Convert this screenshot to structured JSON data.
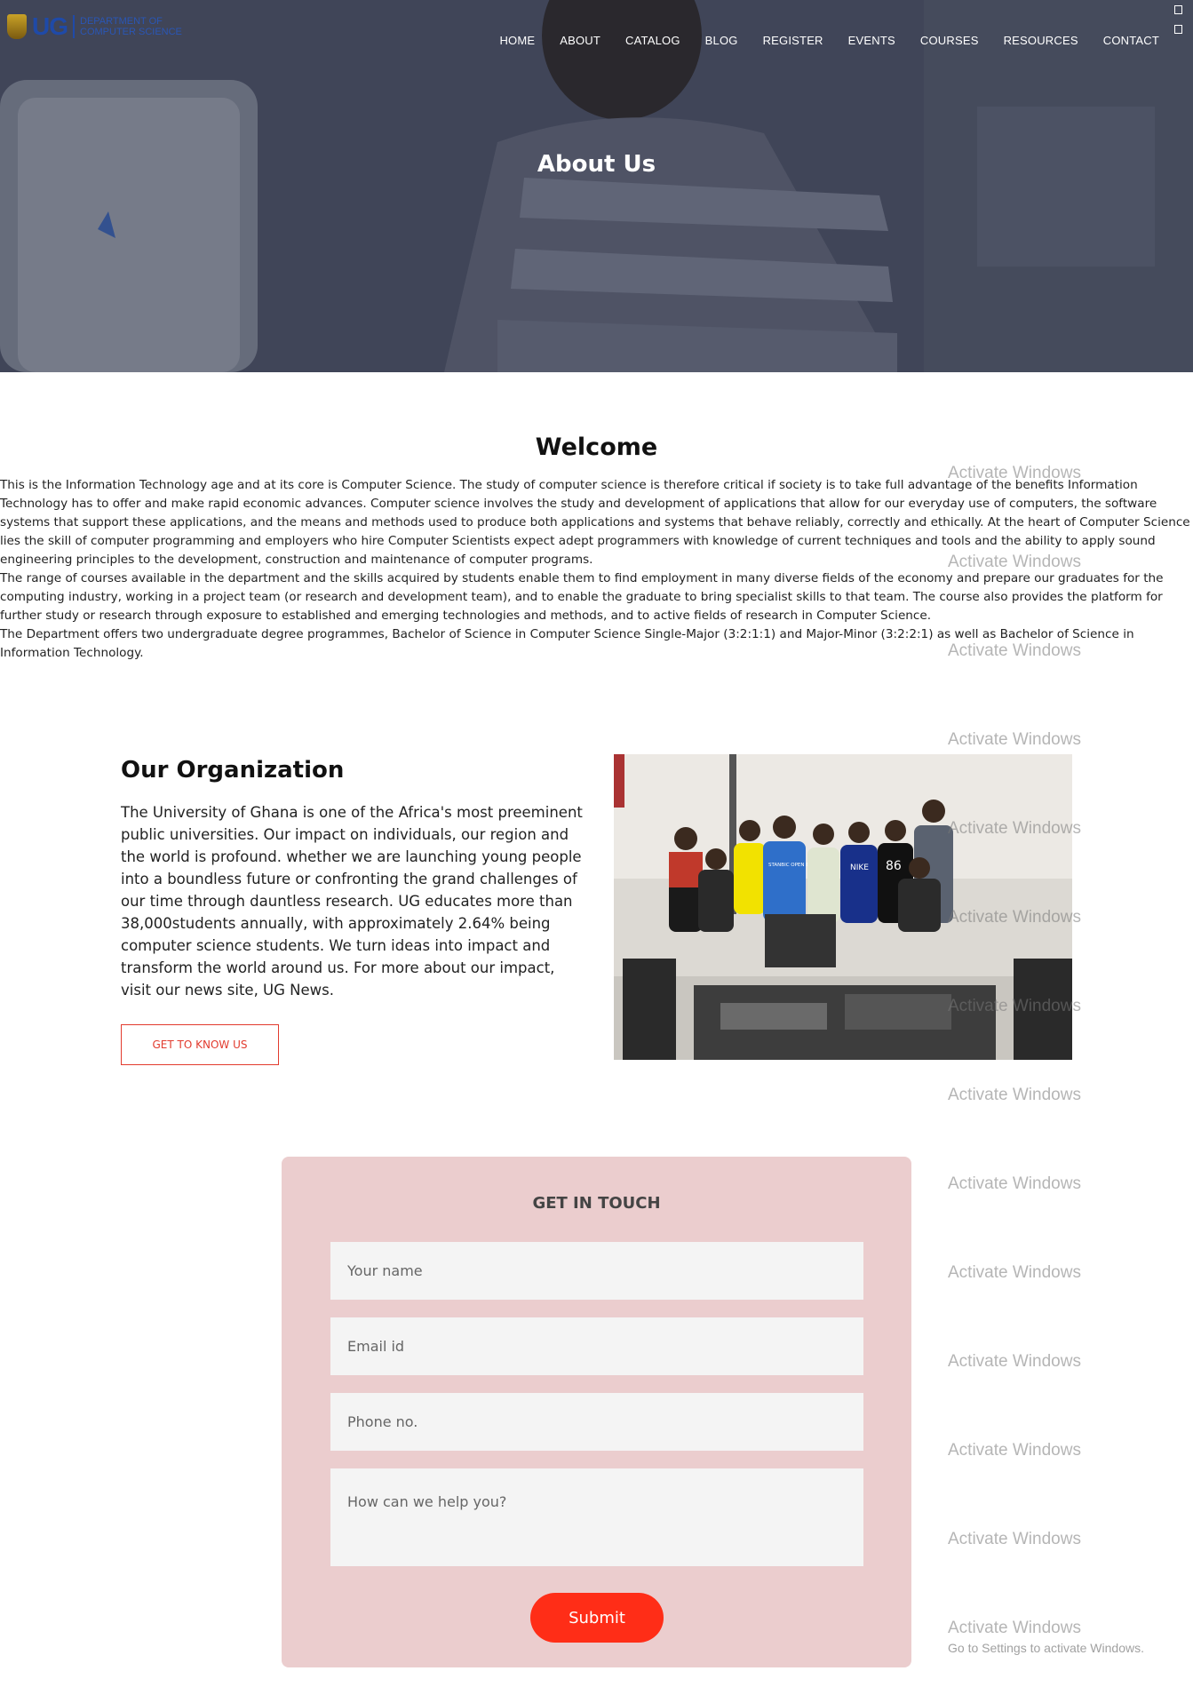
{
  "header": {
    "logo": {
      "ug": "UG",
      "dept_line1": "DEPARTMENT OF",
      "dept_line2": "COMPUTER SCIENCE"
    },
    "nav": [
      "HOME",
      "ABOUT",
      "CATALOG",
      "BLOG",
      "REGISTER",
      "EVENTS",
      "COURSES",
      "RESOURCES",
      "CONTACT"
    ]
  },
  "hero": {
    "title": "About Us"
  },
  "welcome": {
    "title": "Welcome",
    "paragraphs": [
      "This is the Information Technology age and at its core is Computer Science. The study of computer science is therefore critical if society is to take full advantage of the benefits Information Technology has to offer and make rapid economic advances. Computer science involves the study and development of applications that allow for our everyday use of computers, the software systems that support these applications, and the means and methods used to produce both applications and systems that behave reliably, correctly and ethically. At the heart of Computer Science lies the skill of computer programming and employers who hire Computer Scientists expect adept programmers with knowledge of current techniques and tools and the ability to apply sound engineering principles to the development, construction and maintenance of computer programs.",
      "The range of courses available in the department and the skills acquired by students enable them to find employment in many diverse fields of the economy and prepare our graduates for the computing industry, working in a project team (or research and development team), and to enable the graduate to bring specialist skills to that team. The course also provides the platform for further study or research through exposure to established and emerging technologies and methods, and to active fields of research in Computer Science.",
      "The Department offers two undergraduate degree programmes, Bachelor of Science in Computer Science Single-Major (3:2:1:1) and Major-Minor (3:2:2:1) as well as Bachelor of Science in Information Technology."
    ]
  },
  "organization": {
    "title": "Our Organization",
    "body": "The University of Ghana is one of the Africa's most preeminent public universities. Our impact on individuals, our region and the world is profound. whether we are launching young people into a boundless future or confronting the grand challenges of our time through dauntless research. UG educates more than 38,000students annually, with approximately 2.64% being computer science students. We turn ideas into impact and transform the world around us. For more about our impact, visit our news site, UG News.",
    "button": "GET TO KNOW US",
    "shirt_text": {
      "banking": "STANBIC OPEN BANKING",
      "nike": "NIKE",
      "number": "86"
    }
  },
  "contact": {
    "title": "GET IN TOUCH",
    "name_placeholder": "Your name",
    "email_placeholder": "Email id",
    "phone_placeholder": "Phone no.",
    "message_placeholder": "How can we help you?",
    "submit": "Submit"
  },
  "watermark": {
    "text": "Activate Windows",
    "sub": "Go to Settings to activate Windows."
  },
  "colors": {
    "accent": "#ff2d17",
    "button_border": "#e23b2e",
    "form_bg": "#ebcdce"
  }
}
